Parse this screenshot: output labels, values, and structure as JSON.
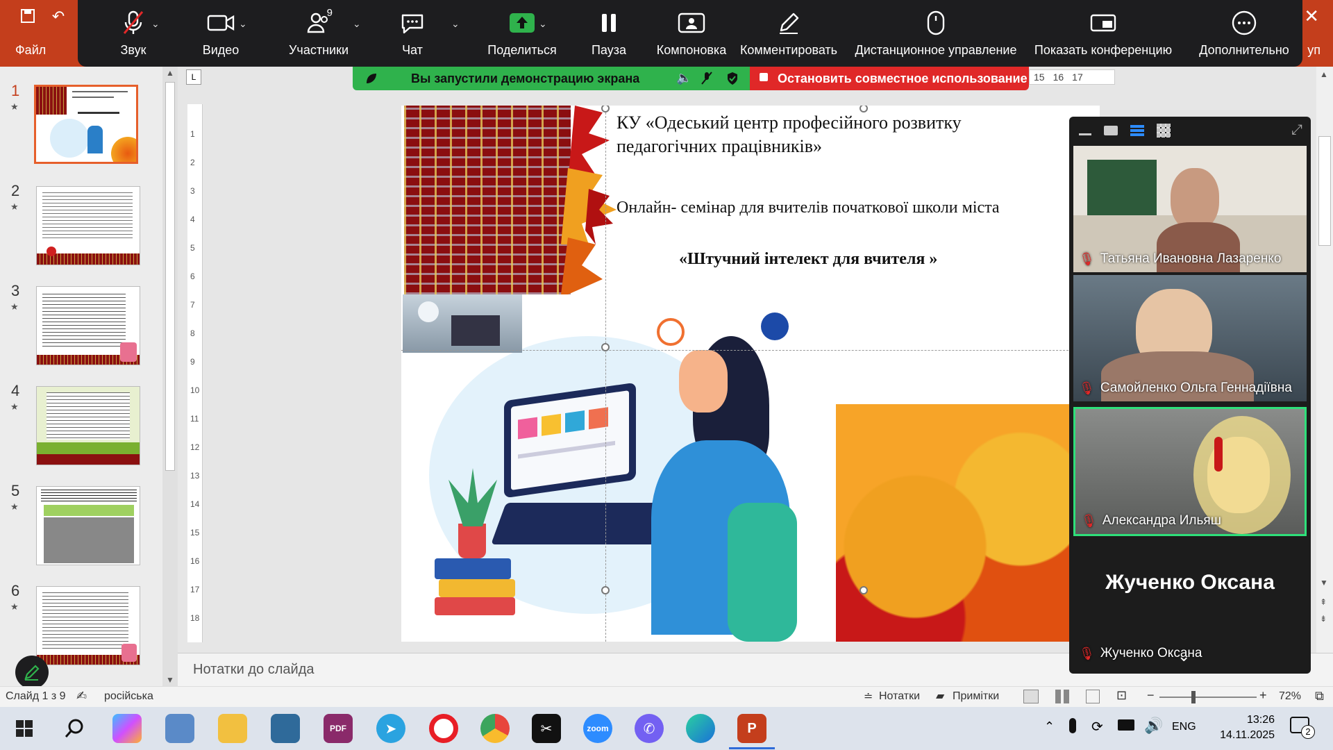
{
  "ppt": {
    "file_tab": "Файл",
    "ribbon_partial_right": "уп",
    "status_slide": "Слайд 1 з 9",
    "status_lang": "російська",
    "notes_btn": "Нотатки",
    "comments_btn": "Примітки",
    "zoom_level": "72%",
    "notes_placeholder": "Нотатки до слайда",
    "ruler_tab": "L"
  },
  "zoom_toolbar": {
    "audio": "Звук",
    "video": "Видео",
    "participants": "Участники",
    "participants_count": "9",
    "chat": "Чат",
    "share": "Поделиться",
    "pause": "Пауза",
    "layout": "Компоновка",
    "annotate": "Комментировать",
    "remote_control": "Дистанционное управление",
    "show_conference": "Показать конференцию",
    "more": "Дополнительно"
  },
  "share_banner": {
    "text": "Вы запустили демонстрацию экрана",
    "stop": "Остановить совместное использование",
    "ruler_marks": [
      "15",
      "16",
      "17"
    ]
  },
  "slide": {
    "org_line1": "КУ «Одеський  центр  професійного  розвитку",
    "org_line2": "педагогічних  працівників»",
    "seminar": "Онлайн-  семінар для  вчителів  початкової школи міста",
    "title": "«Штучний інтелект для вчителя »"
  },
  "thumbnails": [
    {
      "num": "1"
    },
    {
      "num": "2"
    },
    {
      "num": "3"
    },
    {
      "num": "4"
    },
    {
      "num": "5"
    },
    {
      "num": "6"
    }
  ],
  "vruler_marks": [
    "1",
    "2",
    "3",
    "4",
    "5",
    "6",
    "7",
    "8",
    "9",
    "10",
    "11",
    "12",
    "13",
    "14",
    "15",
    "16",
    "17",
    "18"
  ],
  "participants": [
    {
      "name": "Татьяна Ивановна Лазаренко"
    },
    {
      "name": "Самойленко Ольга Геннадіївна"
    },
    {
      "name": "Александра Ильяш"
    },
    {
      "name": "Жученко Оксана",
      "big_name": "Жученко Оксана"
    }
  ],
  "taskbar": {
    "lang": "ENG",
    "time": "13:26",
    "date": "14.11.2025",
    "notif_count": "2",
    "zoom_label": "zoom"
  },
  "colors": {
    "ppt_accent": "#c43e1c",
    "zoom_bar": "#1d1d1f",
    "share_green": "#2fb24c",
    "stop_red": "#e02828",
    "active_speaker": "#2ee07a"
  }
}
